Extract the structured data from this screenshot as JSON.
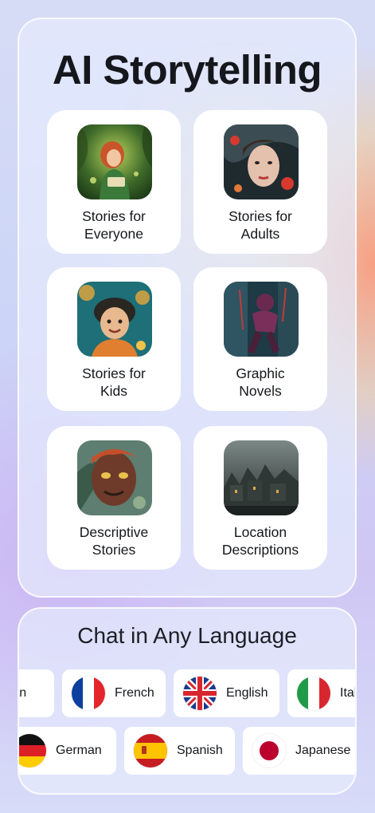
{
  "main": {
    "title": "AI Storytelling",
    "cards": [
      {
        "line1": "Stories for",
        "line2": "Everyone",
        "icon": "forest-reader-icon"
      },
      {
        "line1": "Stories for",
        "line2": "Adults",
        "icon": "woman-portrait-icon"
      },
      {
        "line1": "Stories for",
        "line2": "Kids",
        "icon": "smiling-boy-icon"
      },
      {
        "line1": "Graphic",
        "line2": "Novels",
        "icon": "comic-hero-icon"
      },
      {
        "line1": "Descriptive",
        "line2": "Stories",
        "icon": "creature-face-icon"
      },
      {
        "line1": "Location",
        "line2": "Descriptions",
        "icon": "dark-village-icon"
      }
    ]
  },
  "languages": {
    "title": "Chat in Any Language",
    "row1": [
      {
        "label": "egian",
        "flag": "norwegian-flag-icon"
      },
      {
        "label": "French",
        "flag": "france-flag-icon"
      },
      {
        "label": "English",
        "flag": "uk-flag-icon"
      },
      {
        "label": "Ital",
        "flag": "italy-flag-icon"
      }
    ],
    "row2": [
      {
        "label": "German",
        "flag": "germany-flag-icon"
      },
      {
        "label": "Spanish",
        "flag": "spain-flag-icon"
      },
      {
        "label": "Japanese",
        "flag": "japan-flag-icon"
      }
    ]
  }
}
